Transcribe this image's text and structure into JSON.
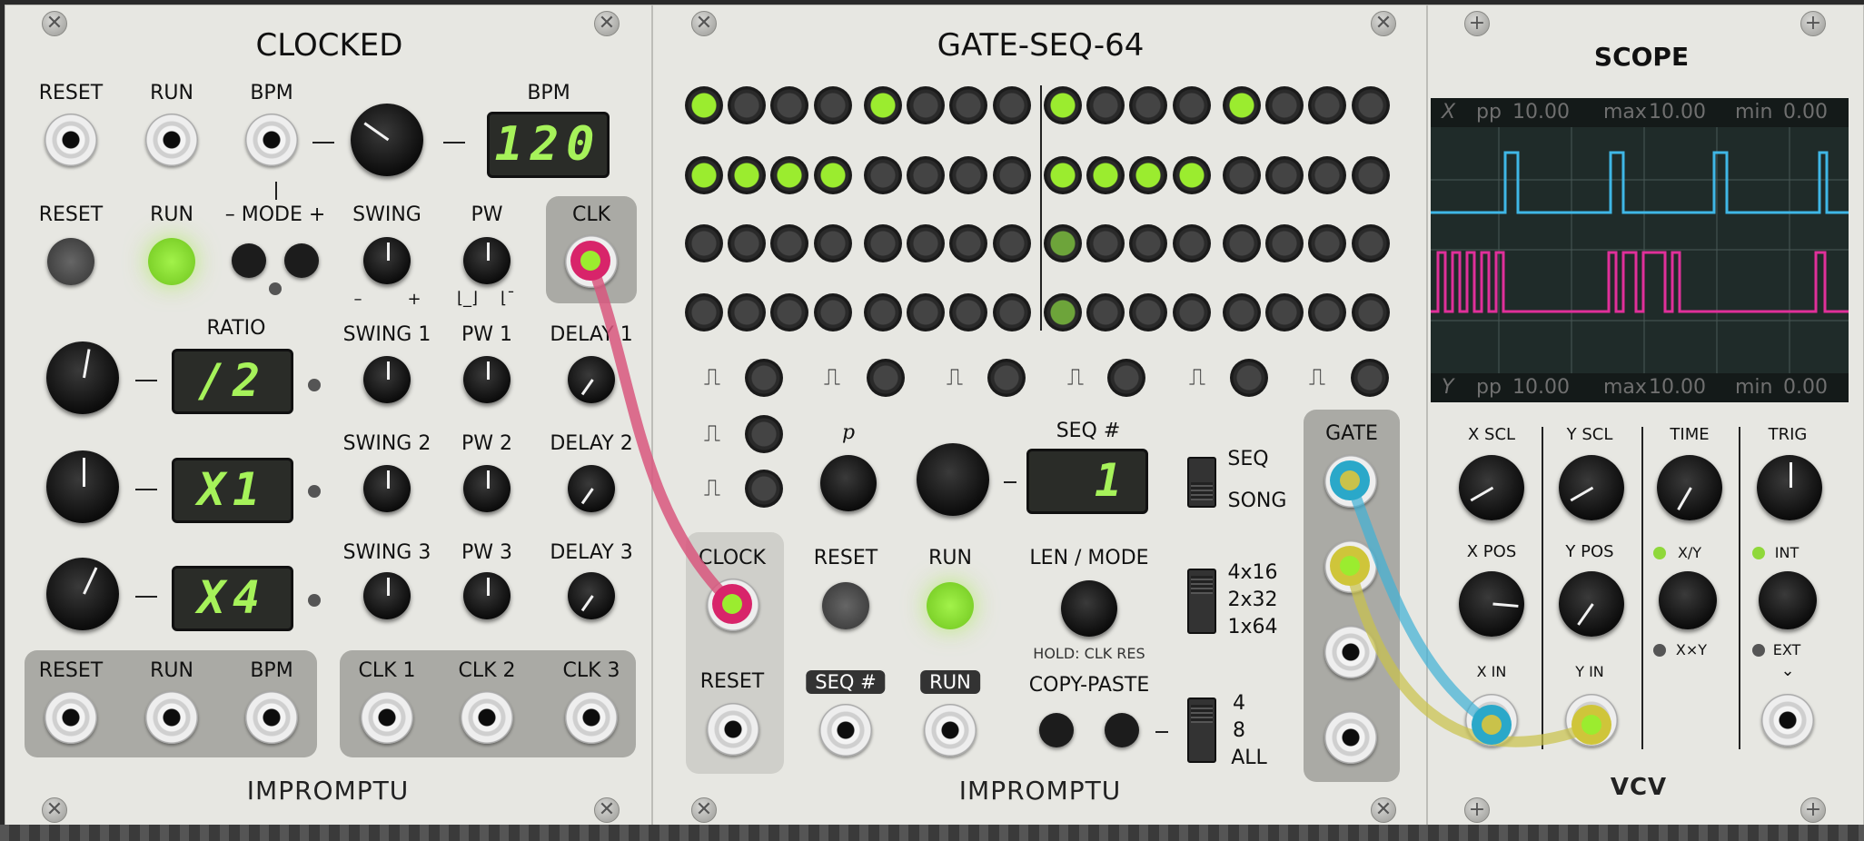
{
  "modules": {
    "clocked": {
      "title": "CLOCKED",
      "brand": "IMPROMPTU",
      "top_jack_labels": [
        "RESET",
        "RUN",
        "BPM"
      ],
      "bpm_label": "BPM",
      "bpm_display": "120",
      "row2": {
        "reset": "RESET",
        "run": "RUN",
        "mode": "– MODE +",
        "swing": "SWING",
        "pw": "PW",
        "clk": "CLK"
      },
      "ratio_label": "RATIO",
      "ratio_displays": [
        "/2",
        "X1",
        "X4"
      ],
      "sub_labels": [
        {
          "swing": "SWING 1",
          "pw": "PW 1",
          "delay": "DELAY 1"
        },
        {
          "swing": "SWING 2",
          "pw": "PW 2",
          "delay": "DELAY 2"
        },
        {
          "swing": "SWING 3",
          "pw": "PW 3",
          "delay": "DELAY 3"
        }
      ],
      "swing_marks": [
        "–",
        "+"
      ],
      "bottom_left": [
        "RESET",
        "RUN",
        "BPM"
      ],
      "bottom_right": [
        "CLK 1",
        "CLK 2",
        "CLK 3"
      ]
    },
    "gateseq": {
      "title": "GATE-SEQ-64",
      "brand": "IMPROMPTU",
      "grid": [
        [
          1,
          0,
          0,
          0,
          1,
          0,
          0,
          0,
          1,
          0,
          0,
          0,
          1,
          0,
          0,
          0
        ],
        [
          1,
          1,
          1,
          1,
          0,
          0,
          0,
          0,
          1,
          1,
          1,
          1,
          0,
          0,
          0,
          0
        ],
        [
          0,
          0,
          0,
          0,
          0,
          0,
          0,
          0,
          2,
          0,
          0,
          0,
          0,
          0,
          0,
          0
        ],
        [
          0,
          0,
          0,
          0,
          0,
          0,
          0,
          0,
          2,
          0,
          0,
          0,
          0,
          0,
          0,
          0
        ]
      ],
      "p_label": "p",
      "seq_num_label": "SEQ #",
      "seq_display": "1",
      "seq_switch": [
        "SEQ",
        "SONG"
      ],
      "clock": "CLOCK",
      "reset_left": "RESET",
      "reset": "RESET",
      "run": "RUN",
      "len_mode": "LEN / MODE",
      "hold_note": "HOLD: CLK RES",
      "len_switch": [
        "4x16",
        "2x32",
        "1x64"
      ],
      "seq_tag": "SEQ #",
      "run_tag": "RUN",
      "copy_paste": "COPY-PASTE",
      "copy_switch": [
        "4",
        "8",
        "ALL"
      ],
      "gate": "GATE"
    },
    "scope": {
      "title": "SCOPE",
      "brand": "VCV",
      "top_bar": {
        "ch": "X",
        "pp": "pp",
        "pp_val": "10.00",
        "max": "max",
        "max_val": "10.00",
        "min": "min",
        "min_val": "0.00"
      },
      "bottom_bar": {
        "ch": "Y",
        "pp": "pp",
        "pp_val": "10.00",
        "max": "max",
        "max_val": "10.00",
        "min": "min",
        "min_val": "0.00"
      },
      "knob_labels": [
        "X SCL",
        "Y SCL",
        "TIME",
        "TRIG"
      ],
      "pos_labels": [
        "X POS",
        "Y POS"
      ],
      "xy_labels": [
        "X/Y",
        "X×Y"
      ],
      "int_ext": [
        "INT",
        "EXT"
      ],
      "in_labels": [
        "X IN",
        "Y IN"
      ],
      "chevron": "⌄"
    }
  },
  "colors": {
    "panel": "#e7e7e2",
    "led_green": "#9bec2f",
    "cable_pink": "#d8577e",
    "cable_cyan": "#3fb1d6",
    "cable_yellow": "#c9c24a",
    "trace_cyan": "#3fb7e6",
    "trace_magenta": "#e0309a"
  }
}
